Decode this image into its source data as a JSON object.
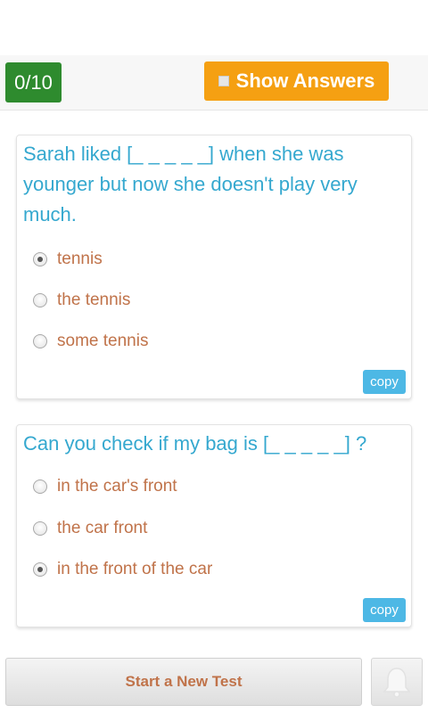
{
  "header": {
    "score": "0/10",
    "show_answers_label": "Show Answers"
  },
  "questions": [
    {
      "text": "Sarah liked [_ _ _ _ _] when she was younger but now she doesn't play very much.",
      "options": [
        {
          "label": "tennis",
          "selected": true
        },
        {
          "label": "the tennis",
          "selected": false
        },
        {
          "label": "some tennis",
          "selected": false
        }
      ],
      "copy_label": "copy"
    },
    {
      "text": "Can you check if my bag is [_ _ _ _ _] ?",
      "options": [
        {
          "label": "in the car's front",
          "selected": false
        },
        {
          "label": "the car front",
          "selected": false
        },
        {
          "label": "in the front of the car",
          "selected": true
        }
      ],
      "copy_label": "copy"
    }
  ],
  "footer": {
    "new_test_label": "Start a New Test",
    "bell_icon": "bell-icon"
  },
  "colors": {
    "score_bg": "#2e8b2e",
    "show_answers_bg": "#f5a012",
    "question_text": "#35a8cf",
    "option_text": "#c0734a",
    "copy_bg": "#4db8e5"
  }
}
